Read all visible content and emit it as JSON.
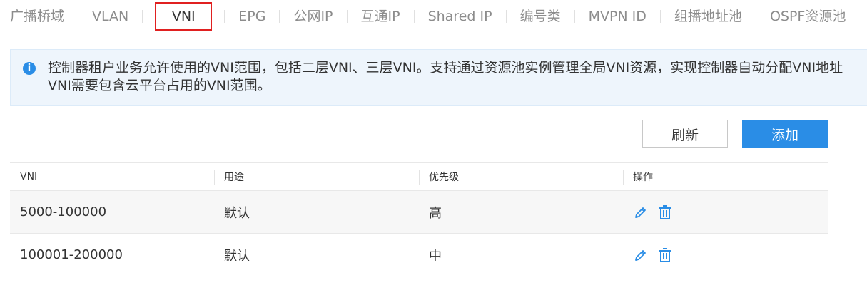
{
  "tabs": [
    {
      "label": "广播桥域",
      "active": false
    },
    {
      "label": "VLAN",
      "active": false
    },
    {
      "label": "VNI",
      "active": true
    },
    {
      "label": "EPG",
      "active": false
    },
    {
      "label": "公网IP",
      "active": false
    },
    {
      "label": "互通IP",
      "active": false
    },
    {
      "label": "Shared IP",
      "active": false
    },
    {
      "label": "编号类",
      "active": false
    },
    {
      "label": "MVPN ID",
      "active": false
    },
    {
      "label": "组播地址池",
      "active": false
    },
    {
      "label": "OSPF资源池",
      "active": false
    }
  ],
  "info": {
    "icon": "info-icon",
    "icon_glyph": "i",
    "line1": "控制器租户业务允许使用的VNI范围，包括二层VNI、三层VNI。支持通过资源池实例管理全局VNI资源，实现控制器自动分配VNI地址",
    "line2": "VNI需要包含云平台占用的VNI范围。"
  },
  "toolbar": {
    "refresh_label": "刷新",
    "add_label": "添加"
  },
  "table": {
    "columns": [
      "VNI",
      "用途",
      "优先级",
      "操作"
    ],
    "rows": [
      {
        "vni": "5000-100000",
        "usage": "默认",
        "priority": "高"
      },
      {
        "vni": "100001-200000",
        "usage": "默认",
        "priority": "中"
      }
    ]
  },
  "colors": {
    "accent": "#2a8de6",
    "active_tab_border": "#e02020",
    "banner_bg": "#eef5fc"
  }
}
